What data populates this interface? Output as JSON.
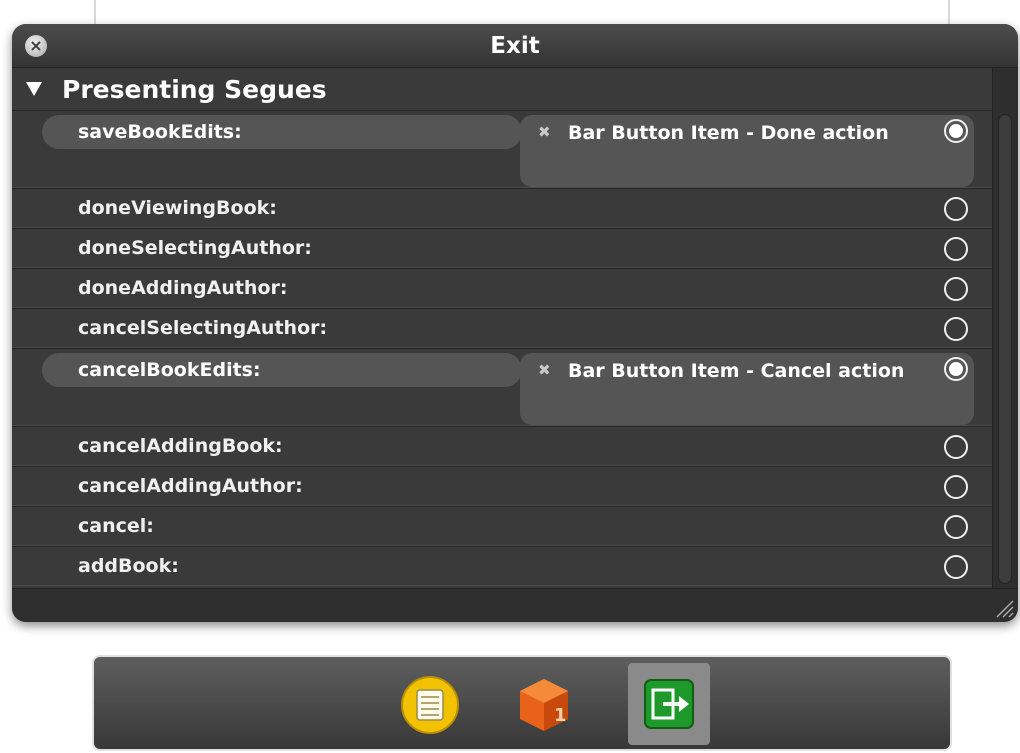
{
  "window": {
    "title": "Exit",
    "close_glyph": "×"
  },
  "section": {
    "title": "Presenting Segues"
  },
  "rows": [
    {
      "label": "saveBookEdits:",
      "connected": true,
      "connection_text": "Bar Button Item - Done action",
      "remove_glyph": "✖"
    },
    {
      "label": "doneViewingBook:",
      "connected": false
    },
    {
      "label": "doneSelectingAuthor:",
      "connected": false
    },
    {
      "label": "doneAddingAuthor:",
      "connected": false
    },
    {
      "label": "cancelSelectingAuthor:",
      "connected": false
    },
    {
      "label": "cancelBookEdits:",
      "connected": true,
      "connection_text": "Bar Button Item - Cancel action",
      "remove_glyph": "✖"
    },
    {
      "label": "cancelAddingBook:",
      "connected": false
    },
    {
      "label": "cancelAddingAuthor:",
      "connected": false
    },
    {
      "label": "cancel:",
      "connected": false
    },
    {
      "label": "addBook:",
      "connected": false
    }
  ],
  "dock": {
    "icons": [
      {
        "name": "view-controller-icon",
        "selected": false
      },
      {
        "name": "first-responder-icon",
        "selected": false
      },
      {
        "name": "exit-icon",
        "selected": true
      }
    ]
  },
  "colors": {
    "hud_background": "#3a3a3a",
    "connection_background": "#555555",
    "exit_green": "#1d9a2a",
    "view_controller_yellow": "#f2c200",
    "first_responder_orange": "#e8621a"
  }
}
